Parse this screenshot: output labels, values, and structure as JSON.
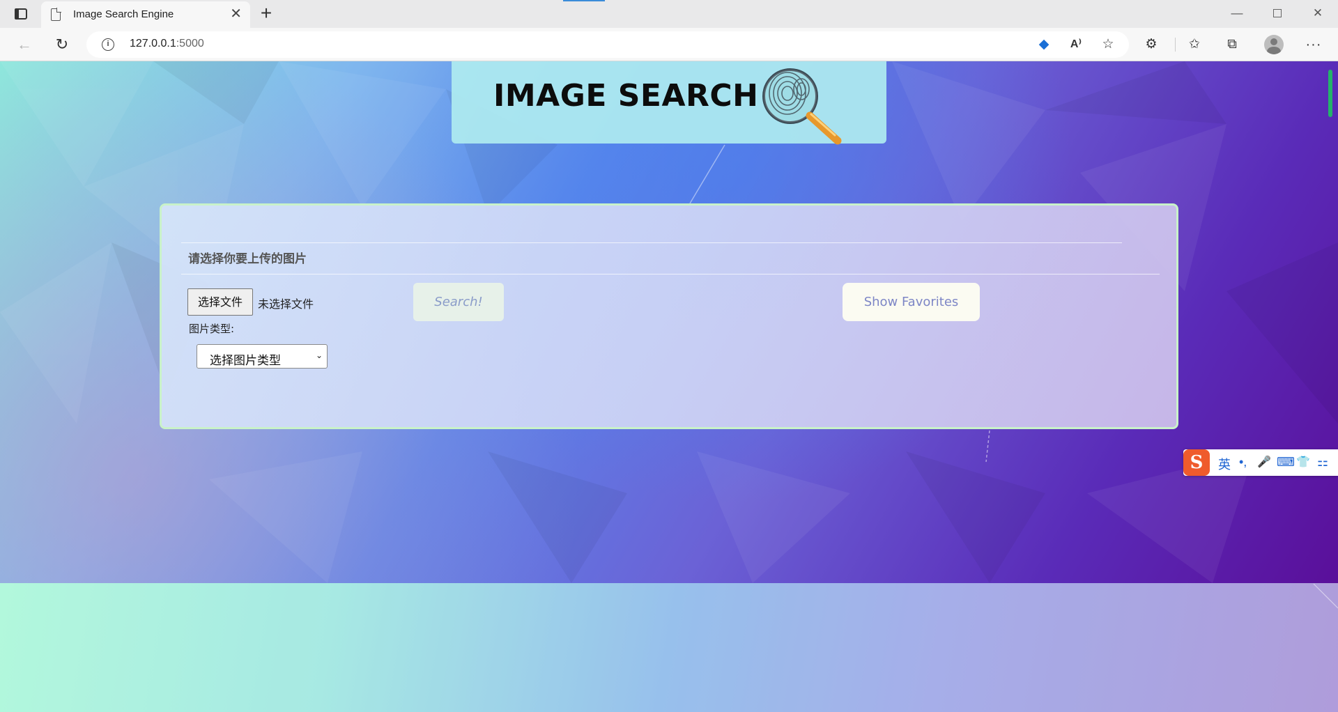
{
  "browser": {
    "tab_title": "Image Search Engine",
    "tab_close": "✕",
    "new_tab": "+",
    "url_host": "127.0.0.1",
    "url_port": ":5000",
    "win_min": "—",
    "win_close": "✕",
    "more": "···"
  },
  "header": {
    "title": "IMAGE SEARCH"
  },
  "form": {
    "upload_label": "请选择你要上传的图片",
    "file_button": "选择文件",
    "file_status": "未选择文件",
    "type_label": "图片类型:",
    "type_select_value": "选择图片类型",
    "search_button": "Search!",
    "favorites_button": "Show Favorites"
  },
  "ime": {
    "logo": "S",
    "lang": "英",
    "punct": "•,",
    "mic": "🎤",
    "keyboard": "⌨",
    "skin": "👕",
    "apps": "⚏"
  },
  "colors": {
    "panel_border": "#c9f2c9",
    "header_bg": "#afecf0",
    "ime_brand": "#ef5b2c"
  }
}
